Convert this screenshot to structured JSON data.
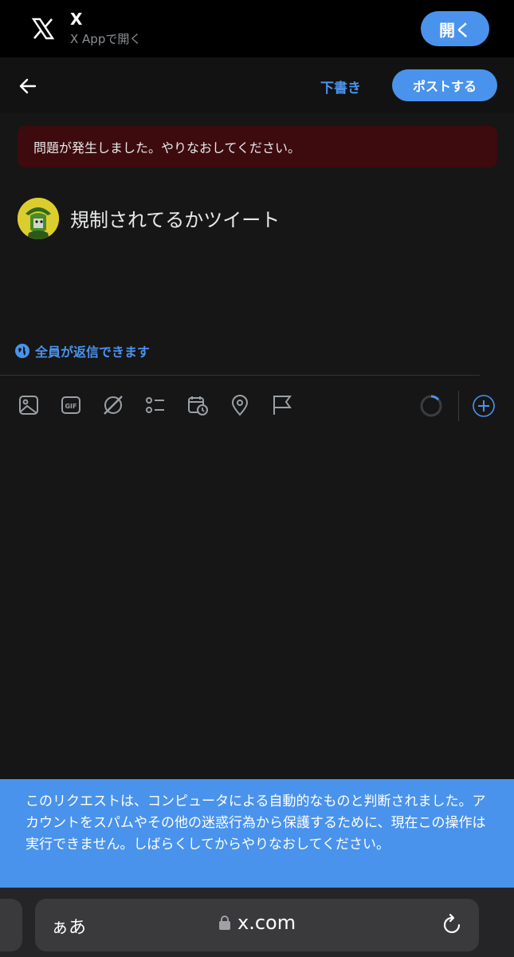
{
  "banner": {
    "app_name": "X",
    "app_sub": "X Appで開く",
    "open_label": "開く"
  },
  "header": {
    "draft_label": "下書き",
    "post_label": "ポストする"
  },
  "error": {
    "message": "問題が発生しました。やりなおしてください。"
  },
  "compose": {
    "tweet_text": "規制されてるかツイート",
    "reply_setting": "全員が返信できます"
  },
  "toolbar": {
    "icons": [
      "image-icon",
      "gif-icon",
      "grok-icon",
      "poll-icon",
      "schedule-icon",
      "location-icon",
      "flag-icon"
    ]
  },
  "toast": {
    "message": "このリクエストは、コンピュータによる自動的なものと判断されました。アカウントをスパムやその他の迷惑行為から保護するために、現在この操作は実行できません。しばらくしてからやりなおしてください。"
  },
  "browser": {
    "aa_label": "ぁあ",
    "url": "x.com"
  },
  "colors": {
    "accent": "#4a93ec",
    "error_bg": "#3d0b0e",
    "background": "#161616"
  }
}
